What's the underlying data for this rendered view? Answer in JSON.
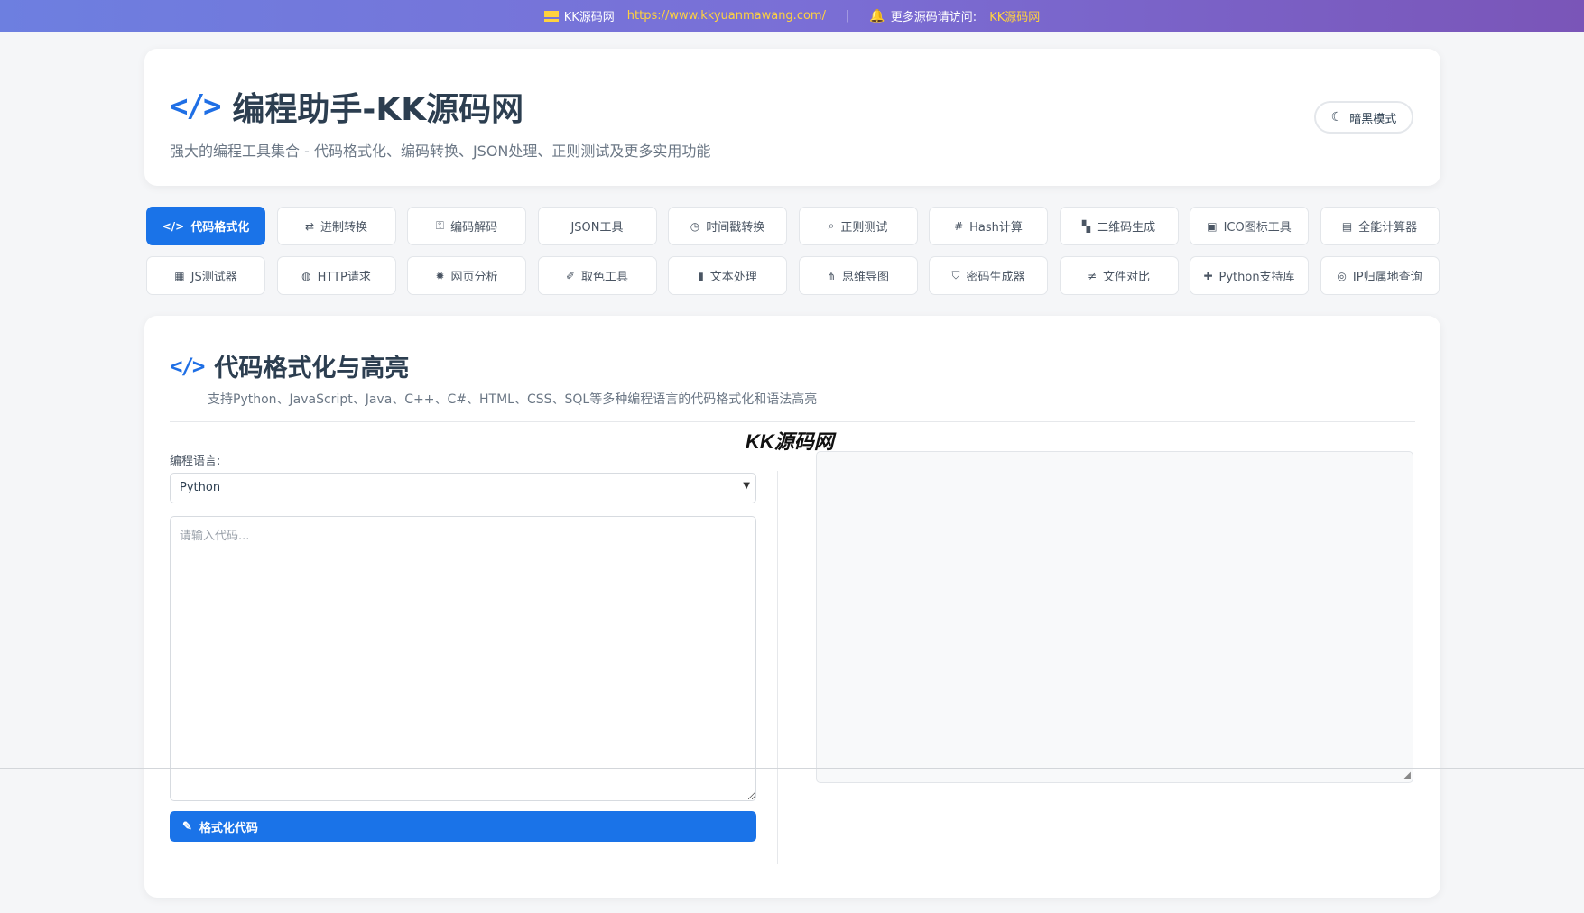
{
  "topbar": {
    "site_name": "KK源码网",
    "site_url": "https://www.kkyuanmawang.com/",
    "separator": "|",
    "more_text": "更多源码请访问:",
    "more_link": "KK源码网",
    "icons": [
      "flag-icon",
      "bell-icon"
    ],
    "accent_color": "#ffd23f"
  },
  "header": {
    "title": "编程助手-KK源码网",
    "subtitle": "强大的编程工具集合 - 代码格式化、编码转换、JSON处理、正则测试及更多实用功能",
    "dark_mode_label": "暗黑模式",
    "brand_color": "#1a73e8"
  },
  "tabs": [
    {
      "label": "代码格式化",
      "icon": "code-icon",
      "active": true
    },
    {
      "label": "进制转换",
      "icon": "swap-icon"
    },
    {
      "label": "编码解码",
      "icon": "key-icon"
    },
    {
      "label": "JSON工具",
      "icon": "json-icon"
    },
    {
      "label": "时间戳转换",
      "icon": "clock-icon"
    },
    {
      "label": "正则测试",
      "icon": "search-icon"
    },
    {
      "label": "Hash计算",
      "icon": "hash-icon"
    },
    {
      "label": "二维码生成",
      "icon": "qrcode-icon"
    },
    {
      "label": "ICO图标工具",
      "icon": "image-icon"
    },
    {
      "label": "全能计算器",
      "icon": "calculator-icon"
    },
    {
      "label": "JS测试器",
      "icon": "js-icon"
    },
    {
      "label": "HTTP请求",
      "icon": "globe-icon"
    },
    {
      "label": "网页分析",
      "icon": "bug-icon"
    },
    {
      "label": "取色工具",
      "icon": "eyedropper-icon"
    },
    {
      "label": "文本处理",
      "icon": "file-icon"
    },
    {
      "label": "思维导图",
      "icon": "sitemap-icon"
    },
    {
      "label": "密码生成器",
      "icon": "shield-icon"
    },
    {
      "label": "文件对比",
      "icon": "not-equal-icon"
    },
    {
      "label": "Python支持库",
      "icon": "puzzle-icon"
    },
    {
      "label": "IP归属地查询",
      "icon": "globe-americas-icon"
    }
  ],
  "formatter": {
    "title": "代码格式化与高亮",
    "description": "支持Python、JavaScript、Java、C++、C#、HTML、CSS、SQL等多种编程语言的代码格式化和语法高亮",
    "language_label": "编程语言:",
    "language_value": "Python",
    "input_placeholder": "请输入代码...",
    "format_button": "格式化代码"
  },
  "watermark": "KK源码网"
}
